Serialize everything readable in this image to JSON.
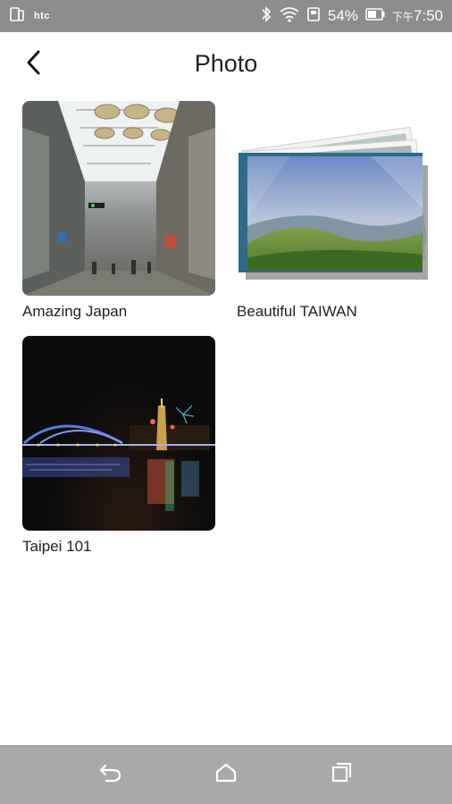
{
  "status_bar": {
    "carrier": "htc",
    "battery": "54%",
    "time_prefix": "下午",
    "time": "7:50",
    "icons": [
      "sim-icon",
      "bluetooth-icon",
      "wifi-icon",
      "storage-icon",
      "battery-icon"
    ]
  },
  "header": {
    "title": "Photo",
    "back_icon": "chevron-left-icon"
  },
  "albums": [
    {
      "name": "Amazing Japan",
      "thumbnail": "shopping-arcade-photo"
    },
    {
      "name": "Beautiful TAIWAN",
      "thumbnail": "stacked-landscape-photos"
    },
    {
      "name": "Taipei 101",
      "thumbnail": "night-bridge-fireworks-photo"
    }
  ],
  "navigation": {
    "back_icon": "nav-back-icon",
    "home_icon": "nav-home-icon",
    "recents_icon": "nav-recents-icon"
  },
  "colors": {
    "status_bar": "#8c8c8c",
    "nav_bar": "#a9a9a9",
    "background": "#ffffff",
    "text": "#222222"
  }
}
